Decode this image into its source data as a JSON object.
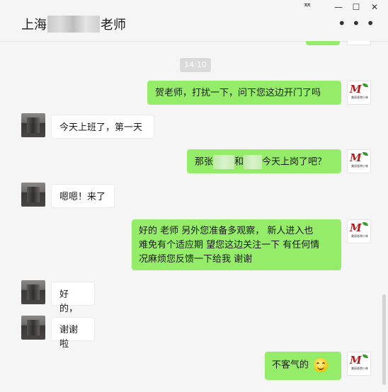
{
  "window": {
    "title_prefix": "上海",
    "title_suffix": "老师",
    "controls": {
      "pin": "ᅑ",
      "minimize": "—",
      "maximize": "☐",
      "close": "✕"
    },
    "more": "• • •"
  },
  "chat": {
    "timestamp": "14:10",
    "messages": [
      {
        "side": "out",
        "text": "贺老师，打扰一下，问下您这边开门了吗"
      },
      {
        "side": "in",
        "text": "今天上班了，第一天"
      },
      {
        "side": "out",
        "text_a": "那张",
        "text_b": "和",
        "text_c": "今天上岗了吧？"
      },
      {
        "side": "in",
        "text": "嗯嗯！来了"
      },
      {
        "side": "out",
        "line1": "好的 老师  另外您准备多观察， 新人进入也",
        "line2": "难免有个适应期 望您这边关注一下 有任何情",
        "line3": "况麻烦您反馈一下给我 谢谢"
      },
      {
        "side": "in",
        "text": "好的，"
      },
      {
        "side": "in",
        "text": "谢谢啦"
      },
      {
        "side": "out",
        "text": "不客气的"
      }
    ],
    "self_avatar": {
      "mark": "M",
      "caption": "美丽香港小林"
    }
  }
}
